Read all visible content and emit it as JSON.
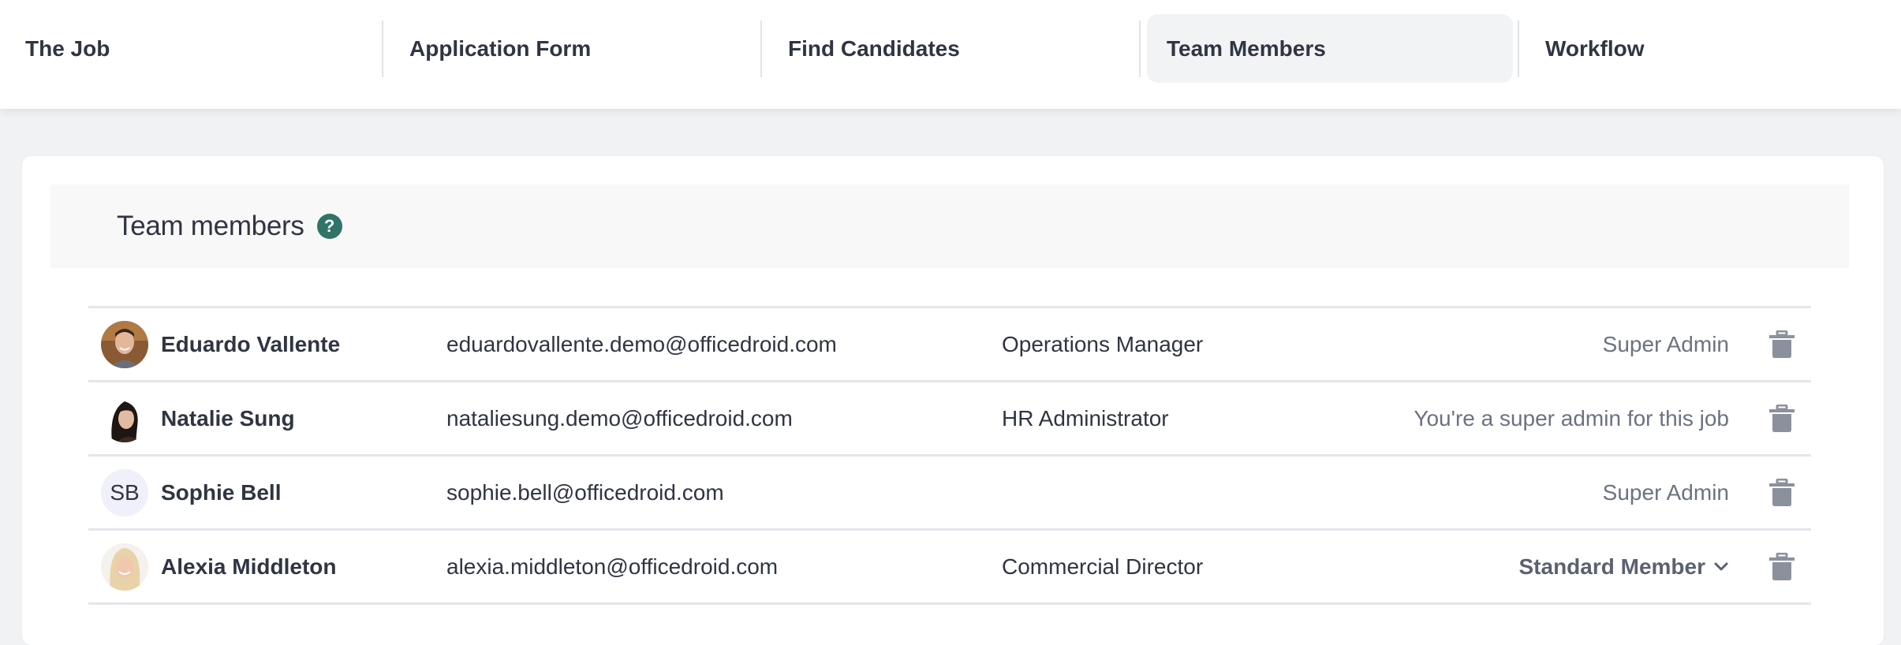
{
  "tabs": [
    {
      "label": "The Job",
      "active": false
    },
    {
      "label": "Application Form",
      "active": false
    },
    {
      "label": "Find Candidates",
      "active": false
    },
    {
      "label": "Team Members",
      "active": true
    },
    {
      "label": "Workflow",
      "active": false
    }
  ],
  "section": {
    "title": "Team members",
    "help_icon_glyph": "?"
  },
  "colors": {
    "accent": "#2f7466",
    "text": "#2f3541",
    "muted": "#6b7280",
    "trash": "#8b919c"
  },
  "members": [
    {
      "name": "Eduardo Vallente",
      "email": "eduardovallente.demo@officedroid.com",
      "job_title": "Operations Manager",
      "role": "Super Admin",
      "avatar": "photo",
      "initials": ""
    },
    {
      "name": "Natalie Sung",
      "email": "nataliesung.demo@officedroid.com",
      "job_title": "HR Administrator",
      "role": "You're a super admin for this job",
      "avatar": "photo",
      "initials": ""
    },
    {
      "name": "Sophie Bell",
      "email": "sophie.bell@officedroid.com",
      "job_title": "",
      "role": "Super Admin",
      "avatar": "initials",
      "initials": "SB"
    },
    {
      "name": "Alexia Middleton",
      "email": "alexia.middleton@officedroid.com",
      "job_title": "Commercial Director",
      "role": "Standard Member",
      "role_is_dropdown": true,
      "avatar": "photo",
      "initials": ""
    }
  ]
}
